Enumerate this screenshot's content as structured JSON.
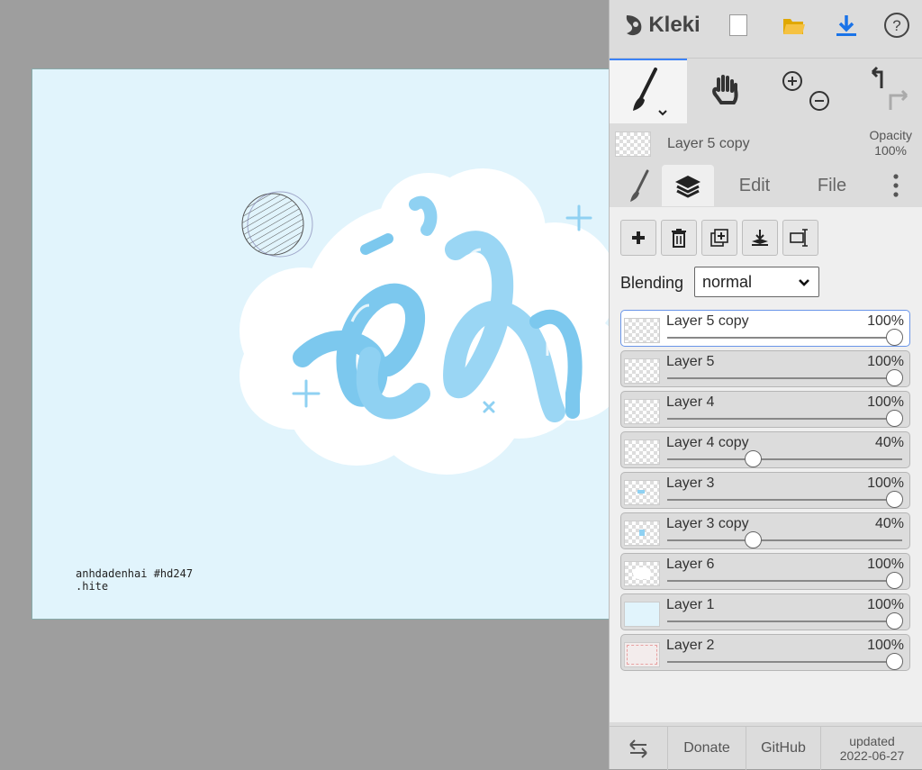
{
  "canvas": {
    "signature_line1": "anhdadenhai #hd247",
    "signature_line2": ".hite",
    "background_color": "#e1f4fc"
  },
  "app": {
    "name": "Kleki",
    "icons": [
      "kleki-logo-icon",
      "new-image-icon",
      "open-folder-icon",
      "download-icon",
      "help-icon"
    ]
  },
  "tools": {
    "icons": [
      "brush-icon",
      "hand-icon",
      "zoom-in-icon",
      "zoom-out-icon",
      "undo-icon",
      "redo-icon"
    ]
  },
  "current_layer": {
    "name": "Layer 5 copy",
    "opacity_label": "Opacity",
    "opacity_value": "100%"
  },
  "tabs": {
    "edit": "Edit",
    "file": "File"
  },
  "layer_buttons": [
    "add-layer",
    "delete-layer",
    "duplicate-layer",
    "merge-down",
    "rename-layer"
  ],
  "blending": {
    "label": "Blending",
    "value": "normal"
  },
  "layers": [
    {
      "name": "Layer 5 copy",
      "opacity": "100%",
      "value": 1.0,
      "active": true
    },
    {
      "name": "Layer 5",
      "opacity": "100%",
      "value": 1.0,
      "active": false
    },
    {
      "name": "Layer 4",
      "opacity": "100%",
      "value": 1.0,
      "active": false
    },
    {
      "name": "Layer 4 copy",
      "opacity": "40%",
      "value": 0.4,
      "active": false
    },
    {
      "name": "Layer 3",
      "opacity": "100%",
      "value": 1.0,
      "active": false
    },
    {
      "name": "Layer 3 copy",
      "opacity": "40%",
      "value": 0.4,
      "active": false
    },
    {
      "name": "Layer 6",
      "opacity": "100%",
      "value": 1.0,
      "active": false
    },
    {
      "name": "Layer 1",
      "opacity": "100%",
      "value": 1.0,
      "active": false
    },
    {
      "name": "Layer 2",
      "opacity": "100%",
      "value": 1.0,
      "active": false
    }
  ],
  "footer": {
    "donate": "Donate",
    "github": "GitHub",
    "updated_label": "updated",
    "updated_date": "2022-06-27"
  },
  "colors": {
    "accent": "#3b82f6",
    "folder": "#f5c242",
    "download": "#1a73e8",
    "sidebar_bg": "#dcdcdc",
    "panel_bg": "#efefef"
  }
}
